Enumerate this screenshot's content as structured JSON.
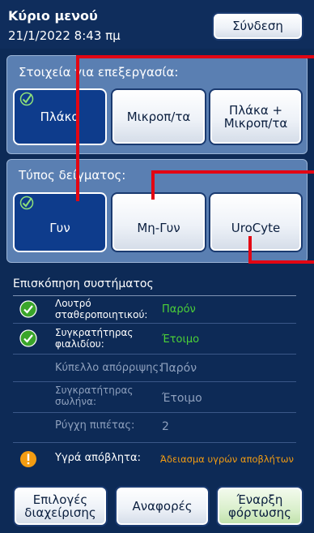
{
  "header": {
    "title": "Κύριο μενού",
    "datetime": "21/1/2022 8:43 πμ",
    "login_label": "Σύνδεση"
  },
  "process_panel": {
    "label": "Στοιχεία για επεξεργασία:",
    "options": [
      {
        "label": "Πλάκα",
        "selected": true
      },
      {
        "label": "Μικροπ/τα",
        "selected": false
      },
      {
        "label_line1": "Πλάκα +",
        "label_line2": "Μικροπ/τα",
        "selected": false
      }
    ]
  },
  "sample_panel": {
    "label": "Τύπος δείγματος:",
    "options": [
      {
        "label": "Γυν",
        "selected": true
      },
      {
        "label": "Μη-Γυν",
        "selected": false
      },
      {
        "label": "UroCyte",
        "selected": false
      }
    ]
  },
  "overview": {
    "title": "Επισκόπηση συστήματος",
    "rows": [
      {
        "label_line1": "Λουτρό",
        "label_line2": "σταθεροποιητικού:",
        "value": "Παρόν",
        "status": "ok",
        "value_color": "#4cd137"
      },
      {
        "label_line1": "Συγκρατήτηρας",
        "label_line2": "φιαλιδίου:",
        "value": "Έτοιμο",
        "status": "ok",
        "value_color": "#4cd137"
      },
      {
        "label": "Κύπελλο απόρριψης:",
        "value": "Παρόν",
        "status": "none"
      },
      {
        "label_line1": "Συγκρατήτηρας",
        "label_line2": "σωλήνα:",
        "value": "Έτοιμο",
        "status": "none"
      },
      {
        "label": "Ρύγχη πιπέτας:",
        "value": "2",
        "status": "none"
      },
      {
        "label": "Υγρά απόβλητα:",
        "value": "Άδειασμα υγρών αποβλήτων",
        "status": "warning",
        "value_color": "#f39c12"
      }
    ]
  },
  "footer": {
    "admin_line1": "Επιλογές",
    "admin_line2": "διαχείρισης",
    "reports": "Αναφορές",
    "start_line1": "Έναρξη",
    "start_line2": "φόρτωσης"
  },
  "colors": {
    "selected": "#0e3c8c",
    "ok": "#4cd137",
    "warning": "#f39c12",
    "annotation": "#e30613"
  }
}
